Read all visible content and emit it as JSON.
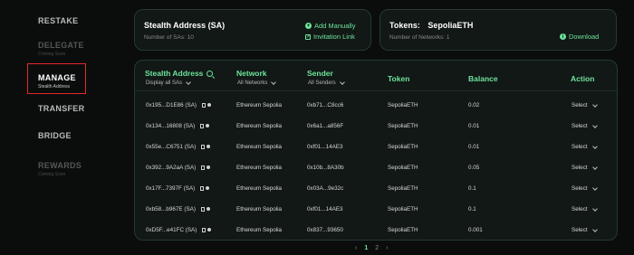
{
  "sidebar": {
    "items": [
      {
        "label": "RESTAKE",
        "sub": ""
      },
      {
        "label": "DELEGATE",
        "sub": "Coming Soon"
      },
      {
        "label": "MANAGE",
        "sub": "Stealth Address"
      },
      {
        "label": "TRANSFER",
        "sub": ""
      },
      {
        "label": "BRIDGE",
        "sub": ""
      },
      {
        "label": "REWARDS",
        "sub": "Coming Soon"
      }
    ]
  },
  "sa_card": {
    "title": "Stealth Address (SA)",
    "count": "Number of SAs: 10",
    "add_manually": "Add Manually",
    "invitation_link": "Invitation Link"
  },
  "token_card": {
    "title": "Tokens:",
    "token": "SepoliaETH",
    "networks": "Number of Networks: 1",
    "download": "Download"
  },
  "table": {
    "headers": {
      "stealth": "Stealth Address",
      "stealth_filter": "Display all SAs",
      "network": "Network",
      "network_filter": "All Networks",
      "sender": "Sender",
      "sender_filter": "All Senders",
      "token": "Token",
      "balance": "Balance",
      "action": "Action"
    },
    "rows": [
      {
        "address": "0x195...D1E86  (SA)",
        "network": "Ethereum Sepolia",
        "sender": "0xb71...C8cc6",
        "token": "SepoliaETH",
        "balance": "0.02",
        "action": "Select"
      },
      {
        "address": "0x134...16808  (SA)",
        "network": "Ethereum Sepolia",
        "sender": "0x6a1...a856F",
        "token": "SepoliaETH",
        "balance": "0.01",
        "action": "Select"
      },
      {
        "address": "0x55e...C6751  (SA)",
        "network": "Ethereum Sepolia",
        "sender": "0xf01...14AE3",
        "token": "SepoliaETH",
        "balance": "0.01",
        "action": "Select"
      },
      {
        "address": "0x392...9A2aA  (SA)",
        "network": "Ethereum Sepolia",
        "sender": "0x10b...8A30b",
        "token": "SepoliaETH",
        "balance": "0.05",
        "action": "Select"
      },
      {
        "address": "0x17F...7397F  (SA)",
        "network": "Ethereum Sepolia",
        "sender": "0x03A...9e32c",
        "token": "SepoliaETH",
        "balance": "0.1",
        "action": "Select"
      },
      {
        "address": "0xb58...b967E  (SA)",
        "network": "Ethereum Sepolia",
        "sender": "0xf01...14AE3",
        "token": "SepoliaETH",
        "balance": "0.1",
        "action": "Select"
      },
      {
        "address": "0xD5F...e41FC  (SA)",
        "network": "Ethereum Sepolia",
        "sender": "0x837...93650",
        "token": "SepoliaETH",
        "balance": "0.001",
        "action": "Select"
      }
    ]
  },
  "pagination": {
    "prev": "‹",
    "current": "1",
    "next_page": "2",
    "next": "›"
  },
  "colors": {
    "accent": "#6fe39b",
    "highlight_box": "#e0282a",
    "background": "#0b0d0d"
  }
}
